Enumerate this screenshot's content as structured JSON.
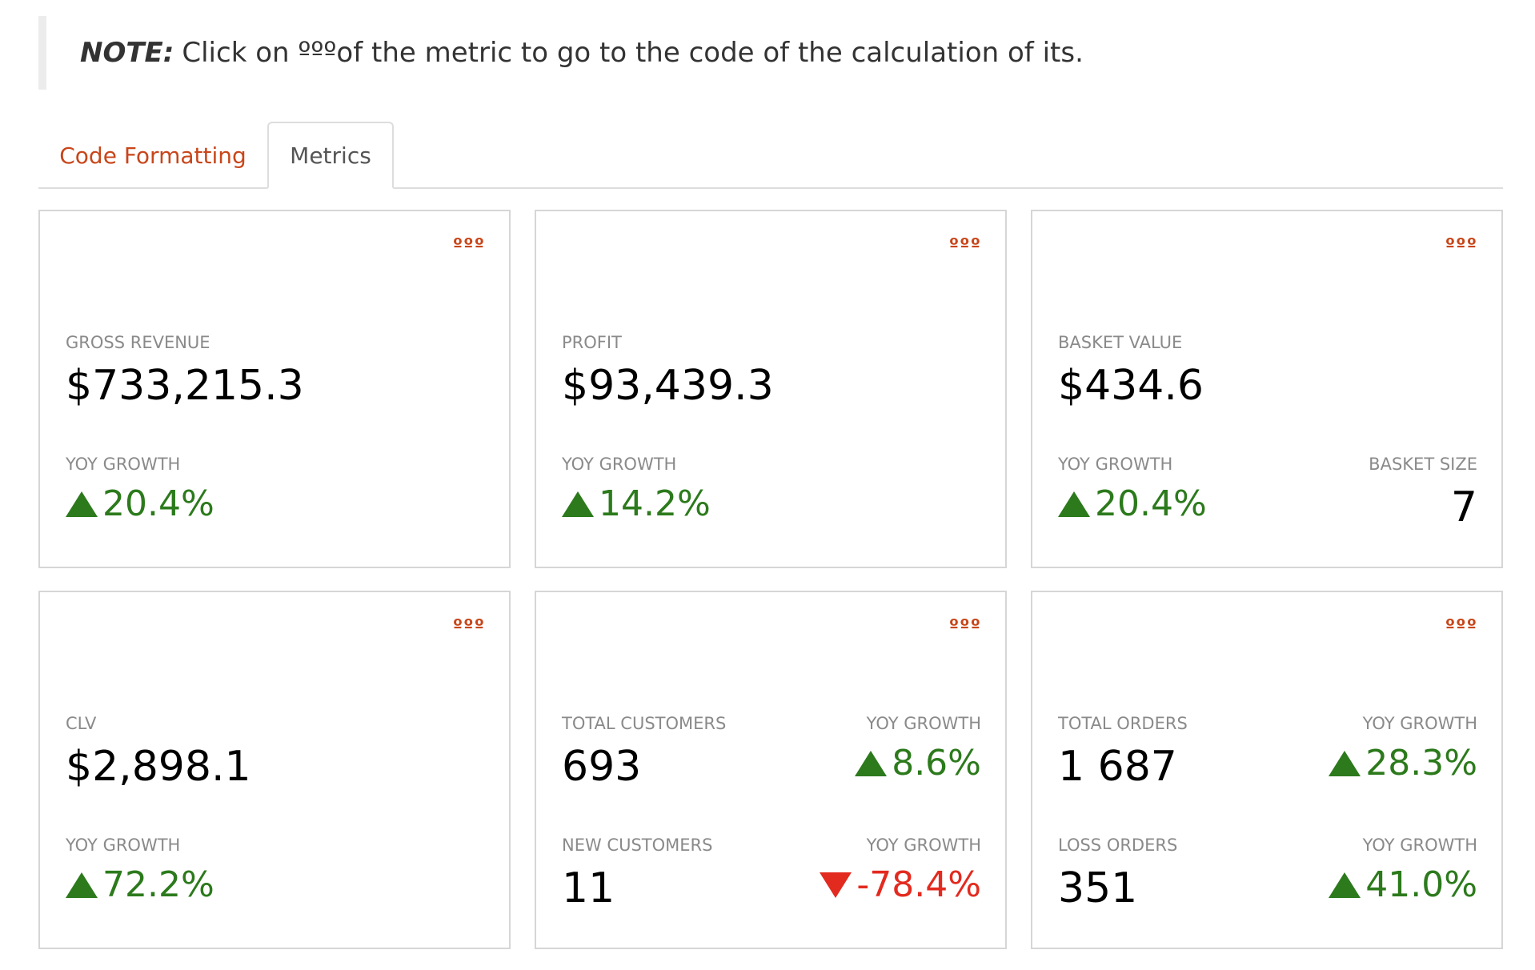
{
  "note": {
    "label": "NOTE:",
    "text": "Click on ºººof the metric to go to the code of the calculation of its."
  },
  "tabs": [
    {
      "label": "Code Formatting"
    },
    {
      "label": "Metrics"
    }
  ],
  "menu_glyph": "ººº",
  "cards": {
    "gross_revenue": {
      "label": "GROSS REVENUE",
      "value": "$733,215.3",
      "growth_label": "YoY GROWTH",
      "growth": "20.4%"
    },
    "profit": {
      "label": "PROFIT",
      "value": "$93,439.3",
      "growth_label": "YoY GROWTH",
      "growth": "14.2%"
    },
    "basket": {
      "label": "BASKET VALUE",
      "value": "$434.6",
      "growth_label": "YoY GROWTH",
      "growth": "20.4%",
      "size_label": "BASKET SIZE",
      "size": "7"
    },
    "clv": {
      "label": "CLV",
      "value": "$2,898.1",
      "growth_label": "YoY GROWTH",
      "growth": "72.2%"
    },
    "customers": {
      "total_label": "TOTAL CUSTOMERS",
      "total": "693",
      "total_growth_label": "YoY GROWTH",
      "total_growth": "8.6%",
      "new_label": "NEW CUSTOMERS",
      "new": "11",
      "new_growth_label": "YoY GROWTH",
      "new_growth": "-78.4%"
    },
    "orders": {
      "total_label": "TOTAL ORDERS",
      "total": "1 687",
      "total_growth_label": "YoY GROWTH",
      "total_growth": "28.3%",
      "loss_label": "LOSS ORDERS",
      "loss": "351",
      "loss_growth_label": "YoY GROWTH",
      "loss_growth": "41.0%"
    }
  },
  "colors": {
    "accent": "#c8461a",
    "positive": "#2c7a1c",
    "negative": "#e32a1f"
  }
}
